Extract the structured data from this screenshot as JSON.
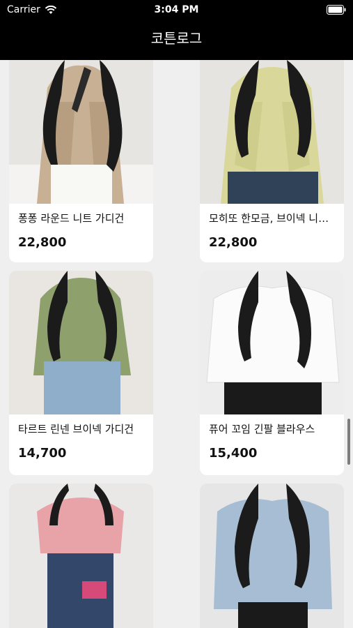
{
  "status_bar": {
    "carrier": "Carrier",
    "time": "3:04 PM"
  },
  "nav": {
    "title": "코튼로그"
  },
  "products": [
    {
      "name": "퐁퐁 라운드 니트 가디건",
      "price": "22,800"
    },
    {
      "name": "모히또 한모금, 브이넥 니트 가디건",
      "price": "22,800"
    },
    {
      "name": "타르트 린넨 브이넥 가디건",
      "price": "14,700"
    },
    {
      "name": "퓨어 꼬임 긴팔 블라우스",
      "price": "15,400"
    }
  ]
}
